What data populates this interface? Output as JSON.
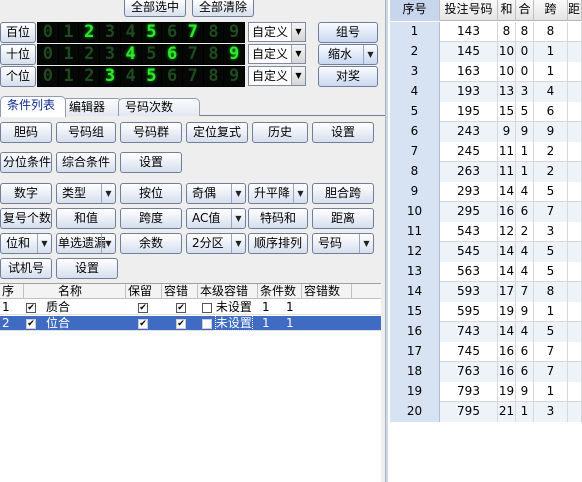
{
  "top_buttons": {
    "select_all": "全部选中",
    "clear_all": "全部清除"
  },
  "digit_rows": [
    {
      "label": "百位",
      "digits": [
        "0",
        "1",
        "2",
        "3",
        "4",
        "5",
        "6",
        "7",
        "8",
        "9"
      ],
      "lit": [
        false,
        false,
        true,
        false,
        false,
        true,
        false,
        true,
        false,
        false
      ],
      "mode": "自定义"
    },
    {
      "label": "十位",
      "digits": [
        "0",
        "1",
        "2",
        "3",
        "4",
        "5",
        "6",
        "7",
        "8",
        "9"
      ],
      "lit": [
        false,
        false,
        false,
        false,
        true,
        false,
        true,
        false,
        false,
        true
      ],
      "mode": "自定义"
    },
    {
      "label": "个位",
      "digits": [
        "0",
        "1",
        "2",
        "3",
        "4",
        "5",
        "6",
        "7",
        "8",
        "9"
      ],
      "lit": [
        false,
        false,
        false,
        true,
        false,
        true,
        false,
        false,
        false,
        false
      ],
      "mode": "自定义"
    }
  ],
  "right_buttons": {
    "group": "组号",
    "shrink": "缩水",
    "lottery": "对奖"
  },
  "tabs": [
    "条件列表",
    "编辑器",
    "号码次数"
  ],
  "conditions": {
    "row1": [
      "胆码",
      "号码组",
      "号码群",
      "定位复式",
      "历史",
      "设置"
    ],
    "row2": [
      "分位条件",
      "综合条件",
      "设置"
    ],
    "row3": [
      "数字",
      "类型",
      "按位",
      "奇偶",
      "升平降",
      "胆合跨"
    ],
    "row4": [
      "复号个数",
      "和值",
      "跨度",
      "AC值",
      "特码和",
      "距离"
    ],
    "row5": [
      "位和",
      "单选遗漏",
      "余数",
      "2分区",
      "顺序排列",
      "号码"
    ],
    "row6": [
      "试机号",
      "设置"
    ]
  },
  "grid": {
    "headers": [
      "序",
      "名称",
      "保留",
      "容错",
      "本级容错",
      "条件数",
      "容错数"
    ],
    "rows": [
      {
        "seq": "1",
        "checked": true,
        "name": "质合",
        "keep": true,
        "fault": true,
        "level_fault": "未设置",
        "count": "1",
        "fault_count": "1",
        "selected": false
      },
      {
        "seq": "2",
        "checked": true,
        "name": "位合",
        "keep": true,
        "fault": true,
        "level_fault": "未设置",
        "count": "1",
        "fault_count": "1",
        "selected": true
      }
    ]
  },
  "result_table": {
    "headers": [
      "序号",
      "投注号码",
      "和",
      "合",
      "跨",
      "距离"
    ],
    "rows": [
      [
        "1",
        "143",
        "8",
        "8",
        "8",
        ""
      ],
      [
        "2",
        "145",
        "10",
        "0",
        "1",
        ""
      ],
      [
        "3",
        "163",
        "10",
        "0",
        "1",
        ""
      ],
      [
        "4",
        "193",
        "13",
        "3",
        "4",
        ""
      ],
      [
        "5",
        "195",
        "15",
        "5",
        "6",
        ""
      ],
      [
        "6",
        "243",
        "9",
        "9",
        "9",
        ""
      ],
      [
        "7",
        "245",
        "11",
        "1",
        "2",
        ""
      ],
      [
        "8",
        "263",
        "11",
        "1",
        "2",
        ""
      ],
      [
        "9",
        "293",
        "14",
        "4",
        "5",
        ""
      ],
      [
        "10",
        "295",
        "16",
        "6",
        "7",
        ""
      ],
      [
        "11",
        "543",
        "12",
        "2",
        "3",
        ""
      ],
      [
        "12",
        "545",
        "14",
        "4",
        "5",
        ""
      ],
      [
        "13",
        "563",
        "14",
        "4",
        "5",
        ""
      ],
      [
        "14",
        "593",
        "17",
        "7",
        "8",
        ""
      ],
      [
        "15",
        "595",
        "19",
        "9",
        "1",
        ""
      ],
      [
        "16",
        "743",
        "14",
        "4",
        "5",
        ""
      ],
      [
        "17",
        "745",
        "16",
        "6",
        "7",
        ""
      ],
      [
        "18",
        "763",
        "16",
        "6",
        "7",
        ""
      ],
      [
        "19",
        "793",
        "19",
        "9",
        "1",
        ""
      ],
      [
        "20",
        "795",
        "21",
        "1",
        "3",
        ""
      ]
    ]
  }
}
